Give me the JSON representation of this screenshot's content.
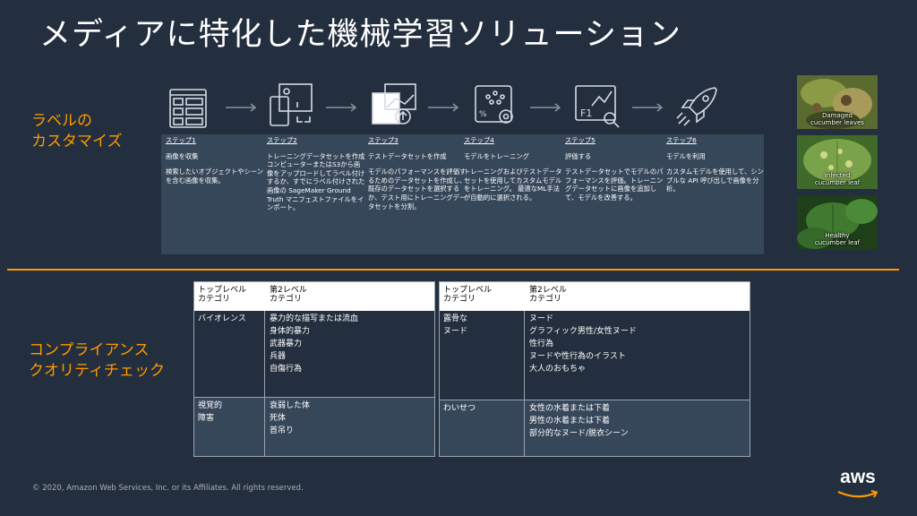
{
  "title": "メディアに特化した機械学習ソリューション",
  "labels_section": "ラベルの\nカスタマイズ",
  "compliance_section": "コンプライアンス\nクオリティチェック",
  "steps": [
    {
      "header": "ステップ1",
      "subtitle": "画像を収集",
      "body": "検索したいオブジェクトやシーンを含む画像を収集。"
    },
    {
      "header": "ステップ2",
      "subtitle": "トレーニングデータセットを作成",
      "body": "コンピューターまたはS3から画像をアップロードしてラベル付けするか、すでにラベル付けされた画像の SageMaker Ground Truth マニフェストファイルをインポート。"
    },
    {
      "header": "ステップ3",
      "subtitle": "テストデータセットを作成",
      "body": "モデルのパフォーマンスを評価するためのデータセットを作成し、既存のデータセットを選択するか、テスト用にトレーニングデータセットを分割。"
    },
    {
      "header": "ステップ4",
      "subtitle": "モデルをトレーニング",
      "body": "トレーニングおよびテストデータセットを使用してカスタムモデルをトレーニング。 最適なML手法が自動的に選択される。"
    },
    {
      "header": "ステップ5",
      "subtitle": "評価する",
      "body": "テストデータセットでモデルのパフォーマンスを評価。トレーニングデータセットに画像を追加して、モデルを改善する。"
    },
    {
      "header": "ステップ6",
      "subtitle": "モデルを利用",
      "body": "カスタムモデルを使用して、シンプルな API 呼び出しで画像を分析。"
    }
  ],
  "photos": [
    {
      "caption": "Damaged\ncucumber leaves",
      "color": "#6b7a3a"
    },
    {
      "caption": "Infected\ncucumber leaf",
      "color": "#5d8a3a"
    },
    {
      "caption": "Healthy\ncucumber leaf",
      "color": "#2f5e2a"
    }
  ],
  "table_left": {
    "col1_header": "トップレベル\nカテゴリ",
    "col2_header": "第2レベル\nカテゴリ",
    "rows": [
      {
        "top": "バイオレンス",
        "second": "暴力的な描写または流血\n身体的暴力\n武器暴力\n兵器\n自傷行為"
      },
      {
        "top": "視覚的\n障害",
        "second": "衰弱した体\n死体\n首吊り"
      }
    ]
  },
  "table_right": {
    "col1_header": "トップレベル\nカテゴリ",
    "col2_header": "第2レベル\nカテゴリ",
    "rows": [
      {
        "top": "露骨な\nヌード",
        "second": "ヌード\nグラフィック男性/女性ヌード\n性行為\nヌードや性行為のイラスト\n大人のおもちゃ"
      },
      {
        "top": "わいせつ",
        "second": "女性の水着または下着\n男性の水着または下着\n部分的なヌード/脱衣シーン"
      }
    ]
  },
  "copyright": "© 2020, Amazon Web Services, Inc. or its Affiliates. All rights reserved.",
  "logo_text": "aws",
  "colors": {
    "background": "#232f3e",
    "accent": "#ff9900",
    "panel": "#37475a"
  }
}
